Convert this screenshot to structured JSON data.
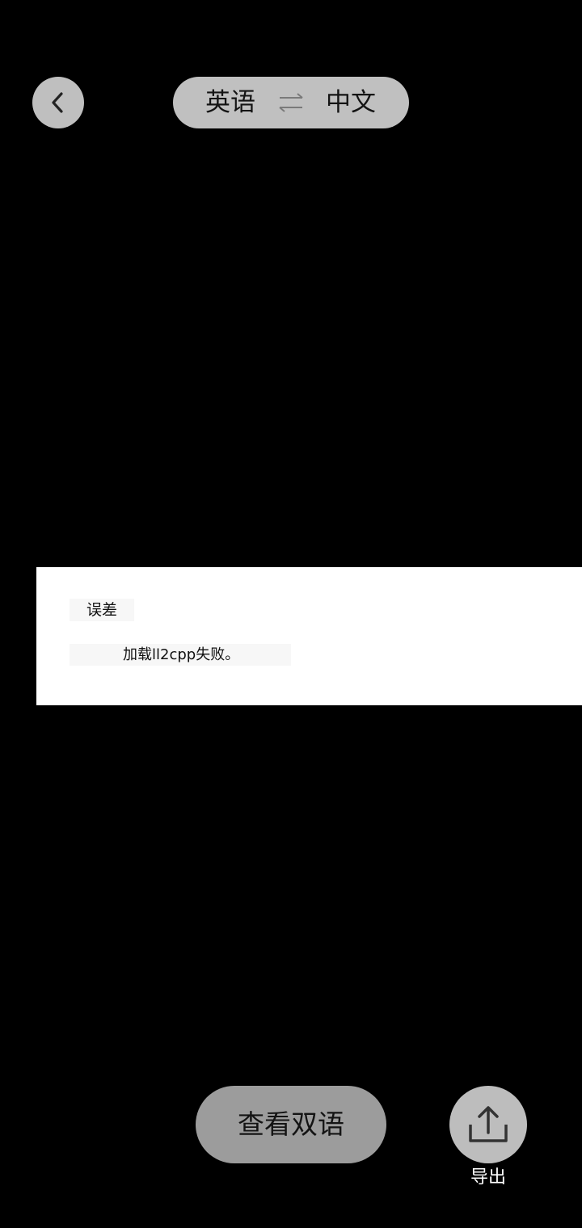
{
  "header": {
    "back_icon": "chevron-left-icon",
    "source_language": "英语",
    "swap_icon": "swap-arrows-icon",
    "target_language": "中文"
  },
  "dialog": {
    "title": "误差",
    "message": "加载ll2cpp失败。"
  },
  "footer": {
    "bilingual_label": "查看双语",
    "export_icon": "share-upload-icon",
    "export_label": "导出"
  },
  "colors": {
    "background": "#000000",
    "button_gray": "#bfbfbf",
    "dialog_bg": "#ffffff"
  }
}
